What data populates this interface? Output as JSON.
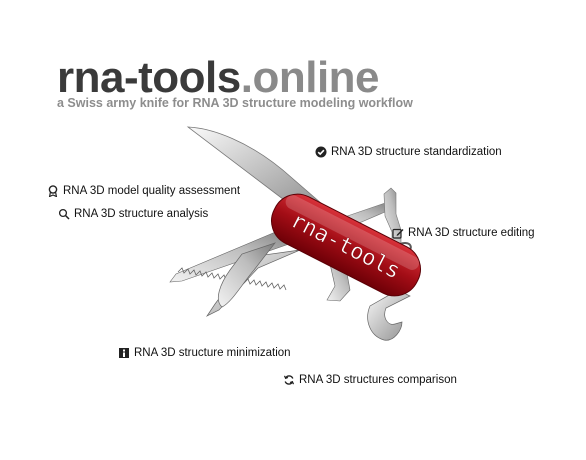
{
  "brand": {
    "name": "rna-tools",
    "tld": ".online",
    "tagline": "a Swiss army knife for RNA 3D structure modeling workflow"
  },
  "knife": {
    "logo_text": "rna-tools",
    "body_color": "#a30d16"
  },
  "features": [
    {
      "id": "standardization",
      "label": "RNA 3D structure standardization",
      "icon": "check-circle-icon"
    },
    {
      "id": "quality",
      "label": "RNA 3D model quality assessment",
      "icon": "award-icon"
    },
    {
      "id": "analysis",
      "label": "RNA 3D structure analysis",
      "icon": "search-icon"
    },
    {
      "id": "editing",
      "label": "RNA 3D structure editing",
      "icon": "edit-icon"
    },
    {
      "id": "minimization",
      "label": "RNA 3D structure minimization",
      "icon": "info-box-icon"
    },
    {
      "id": "comparison",
      "label": "RNA 3D structures comparison",
      "icon": "refresh-icon"
    }
  ]
}
